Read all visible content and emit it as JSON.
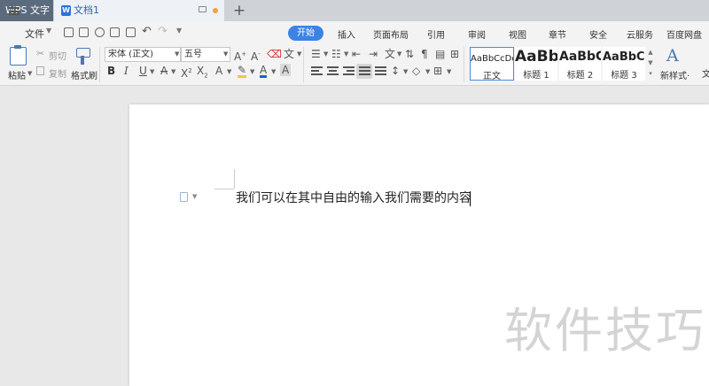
{
  "tabs": {
    "app_label": "WPS 文字",
    "doc_label": "文档1",
    "new_tab": "+"
  },
  "menu": {
    "file_label": "文件",
    "items": [
      "开始",
      "插入",
      "页面布局",
      "引用",
      "审阅",
      "视图",
      "章节",
      "安全",
      "云服务",
      "百度网盘"
    ],
    "active": "开始"
  },
  "ribbon": {
    "paste_label": "粘贴",
    "cut_label": "剪切",
    "copy_label": "复制",
    "format_painter_label": "格式刷",
    "font_name": "宋体 (正文)",
    "font_size": "五号",
    "styles": [
      {
        "preview": "AaBbCcDd",
        "label": "正文"
      },
      {
        "preview": "AaBb",
        "label": "标题 1"
      },
      {
        "preview": "AaBbC",
        "label": "标题 2"
      },
      {
        "preview": "AaBbCc",
        "label": "标题 3"
      }
    ],
    "new_style_label": "新样式·",
    "cut_right_label": "文"
  },
  "document": {
    "text": "我们可以在其中自由的输入我们需要的内容"
  },
  "watermark": "软件技巧",
  "colors": {
    "accent": "#3d83e6",
    "highlight": "#f4c542",
    "font_color": "#1f5fc9",
    "clear_red": "#d33"
  },
  "icons": [
    "menu-icon",
    "save-icon",
    "print-icon",
    "undo-icon",
    "redo-icon",
    "paste-icon",
    "cut-icon",
    "copy-icon",
    "format-painter-icon"
  ]
}
